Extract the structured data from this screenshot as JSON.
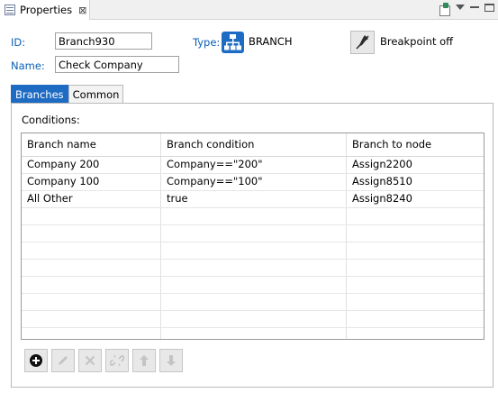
{
  "view": {
    "tab_label": "Properties",
    "close_glyph": "⊠"
  },
  "fields": {
    "id_label": "ID:",
    "id_value": "Branch930",
    "name_label": "Name:",
    "name_value": "Check Company",
    "type_label": "Type:",
    "type_value": "BRANCH",
    "breakpoint_label": "Breakpoint off"
  },
  "tabs": [
    {
      "label": "Branches",
      "active": true
    },
    {
      "label": "Common",
      "active": false
    }
  ],
  "conditions_label": "Conditions:",
  "table": {
    "columns": [
      "Branch name",
      "Branch condition",
      "Branch to node"
    ],
    "rows": [
      [
        "Company 200",
        "Company==\"200\"",
        "Assign2200"
      ],
      [
        "Company 100",
        "Company==\"100\"",
        "Assign8510"
      ],
      [
        "All Other",
        "true",
        "Assign8240"
      ]
    ]
  },
  "toolbar": {
    "buttons": [
      {
        "name": "add-icon",
        "enabled": true
      },
      {
        "name": "edit-icon",
        "enabled": false
      },
      {
        "name": "delete-icon",
        "enabled": false
      },
      {
        "name": "unlink-icon",
        "enabled": false
      },
      {
        "name": "move-up-icon",
        "enabled": false
      },
      {
        "name": "move-down-icon",
        "enabled": false
      }
    ]
  },
  "colors": {
    "accent": "#1e6bc4",
    "link_label": "#0a5fb5"
  }
}
